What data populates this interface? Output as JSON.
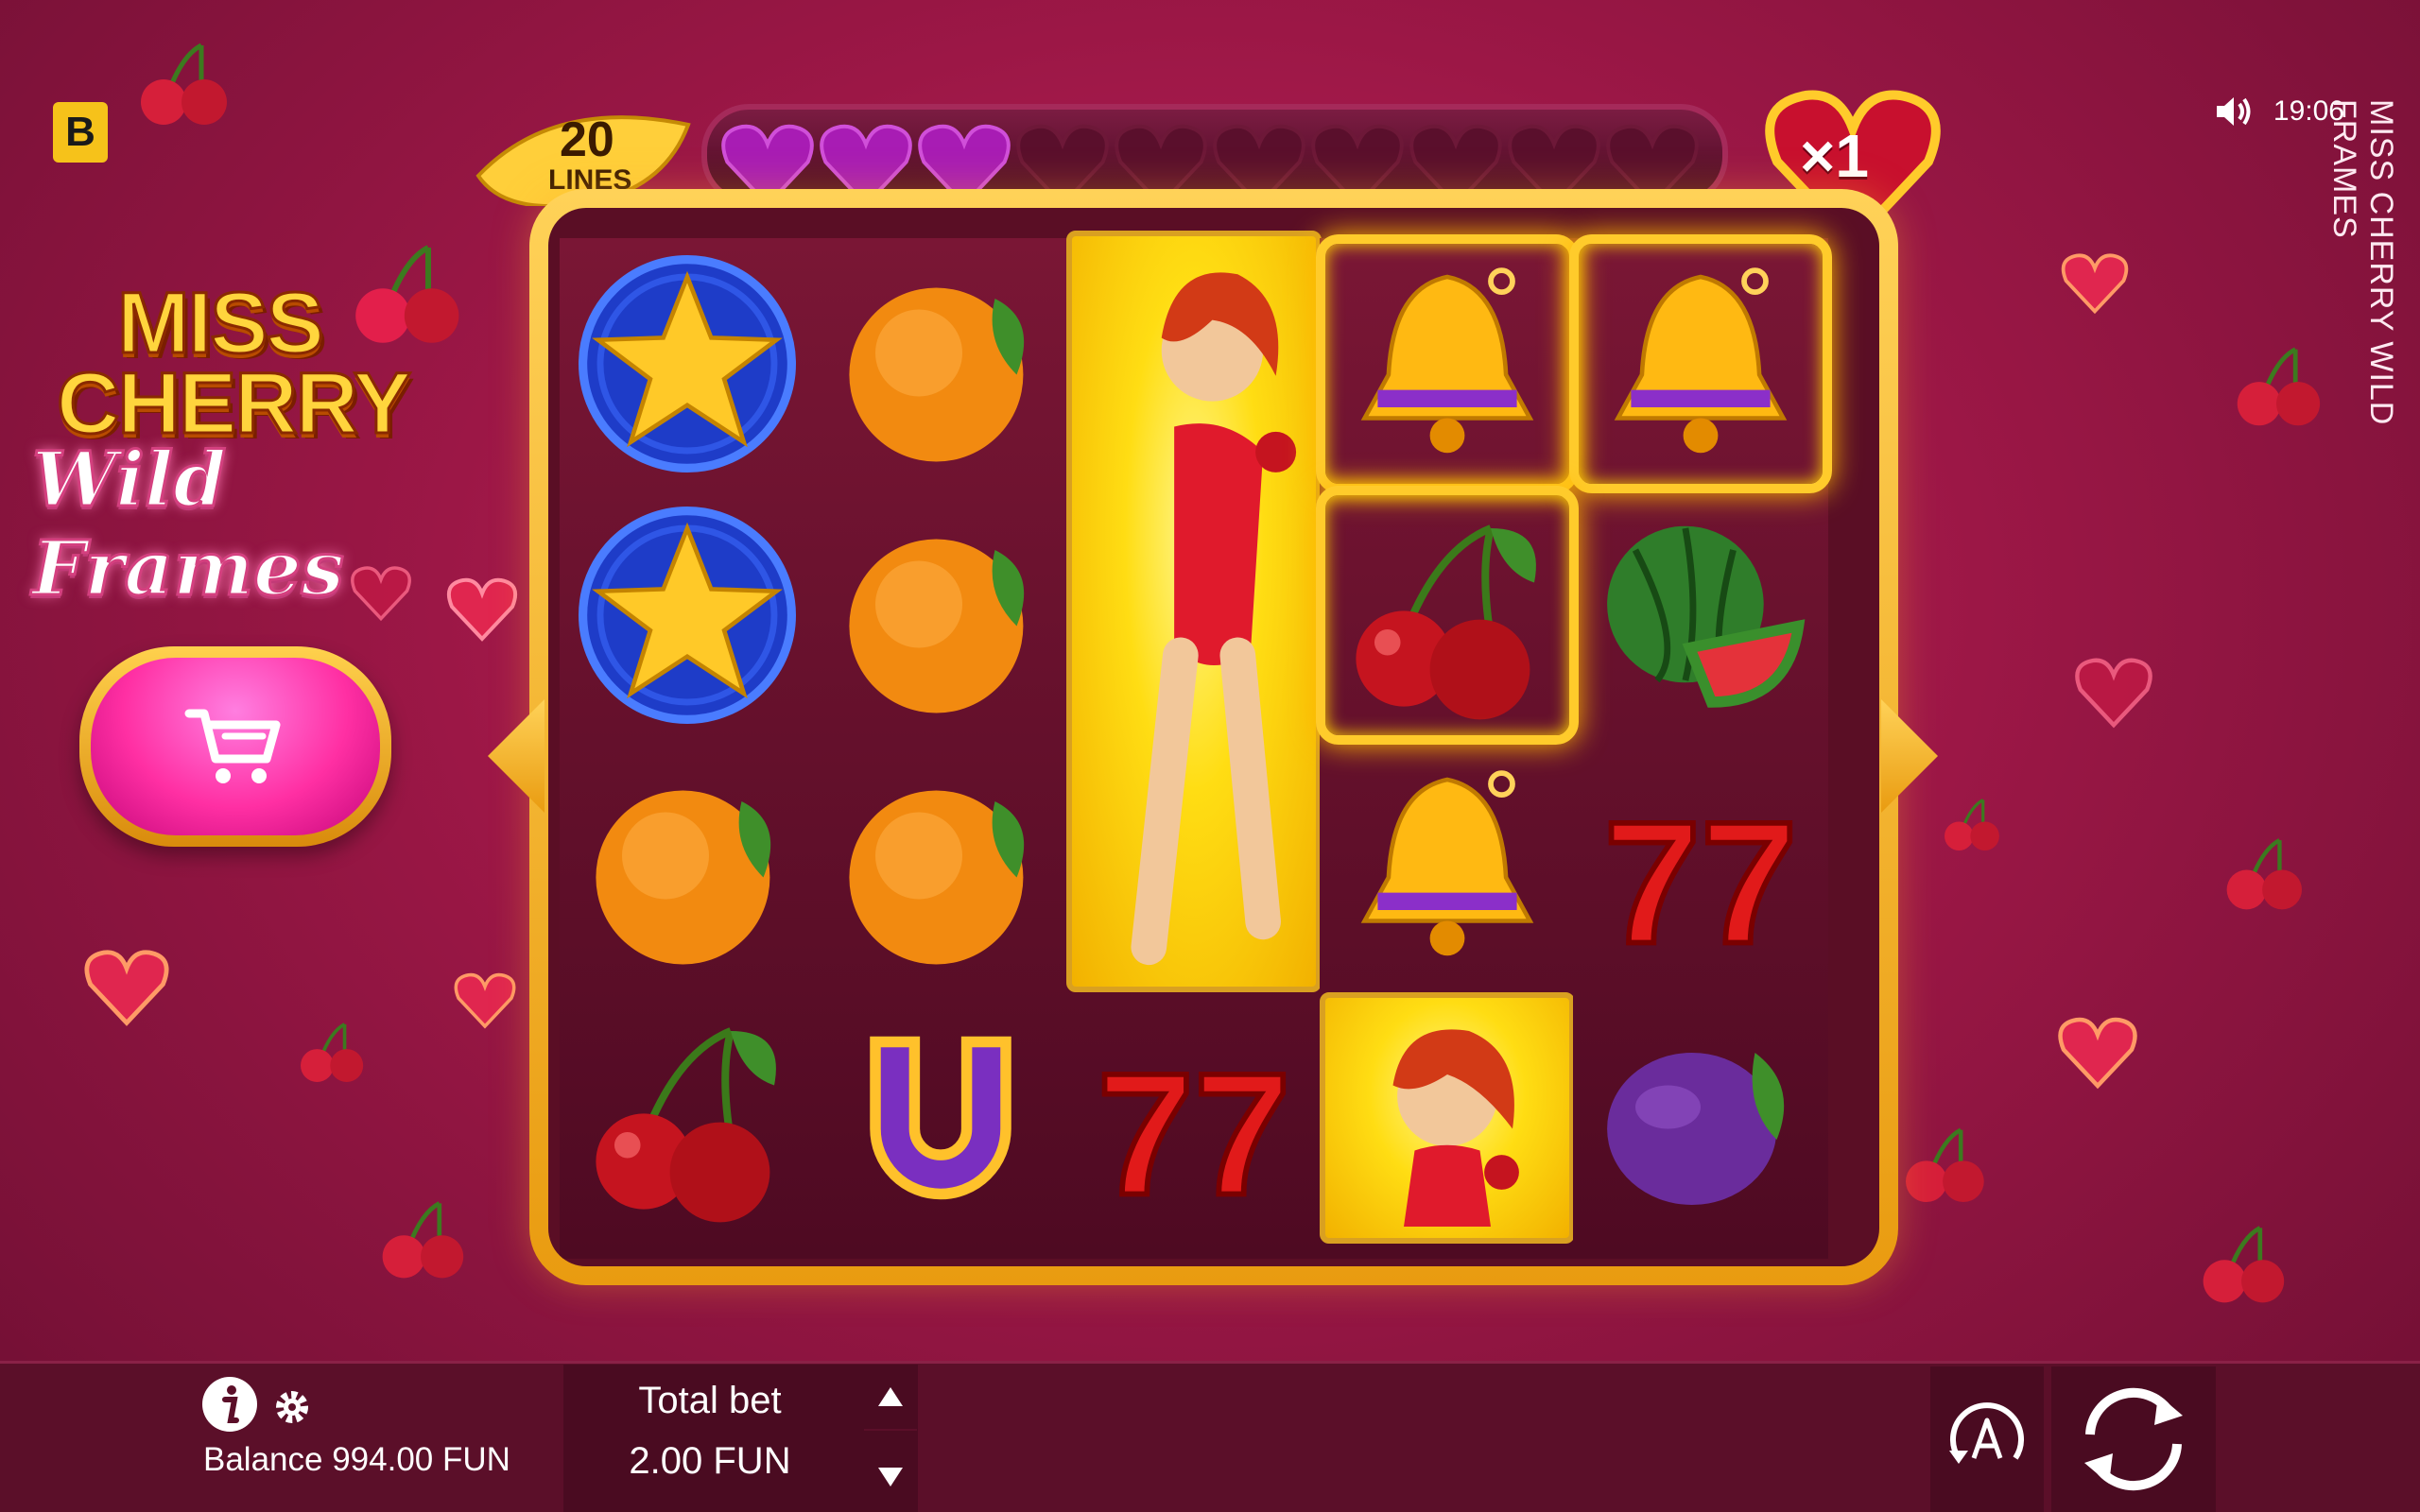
{
  "header": {
    "brand_letter": "B",
    "time": "19:06",
    "game_title_vertical": "MISS CHERRY WILD FRAMES"
  },
  "logo": {
    "line1": "MISS",
    "line2": "CHERRY",
    "line3": "Wild Frames"
  },
  "meter": {
    "lines_count": "20",
    "lines_label": "LINES",
    "hearts_filled": 3,
    "hearts_total": 10,
    "multiplier": "×1"
  },
  "reels": {
    "columns": [
      [
        "star",
        "star",
        "orange",
        "cherry"
      ],
      [
        "orange",
        "orange",
        "orange",
        "horseshoe"
      ],
      [
        "wild-tall",
        "wild-tall",
        "wild-tall",
        "seven"
      ],
      [
        "bell",
        "cherry",
        "bell",
        "wild"
      ],
      [
        "bell",
        "watermelon",
        "seven",
        "plum"
      ]
    ],
    "win_frames": [
      "reel4-row1",
      "reel5-row1",
      "reel4-row2"
    ]
  },
  "bottom_bar": {
    "balance": "Balance 994.00 FUN",
    "total_bet_label": "Total bet",
    "total_bet_value": "2.00 FUN"
  },
  "colors": {
    "background": "#9c1746",
    "gold": "#ffcb2b",
    "panel": "#4a0b21",
    "shop_pink": "#ff2fa3"
  }
}
